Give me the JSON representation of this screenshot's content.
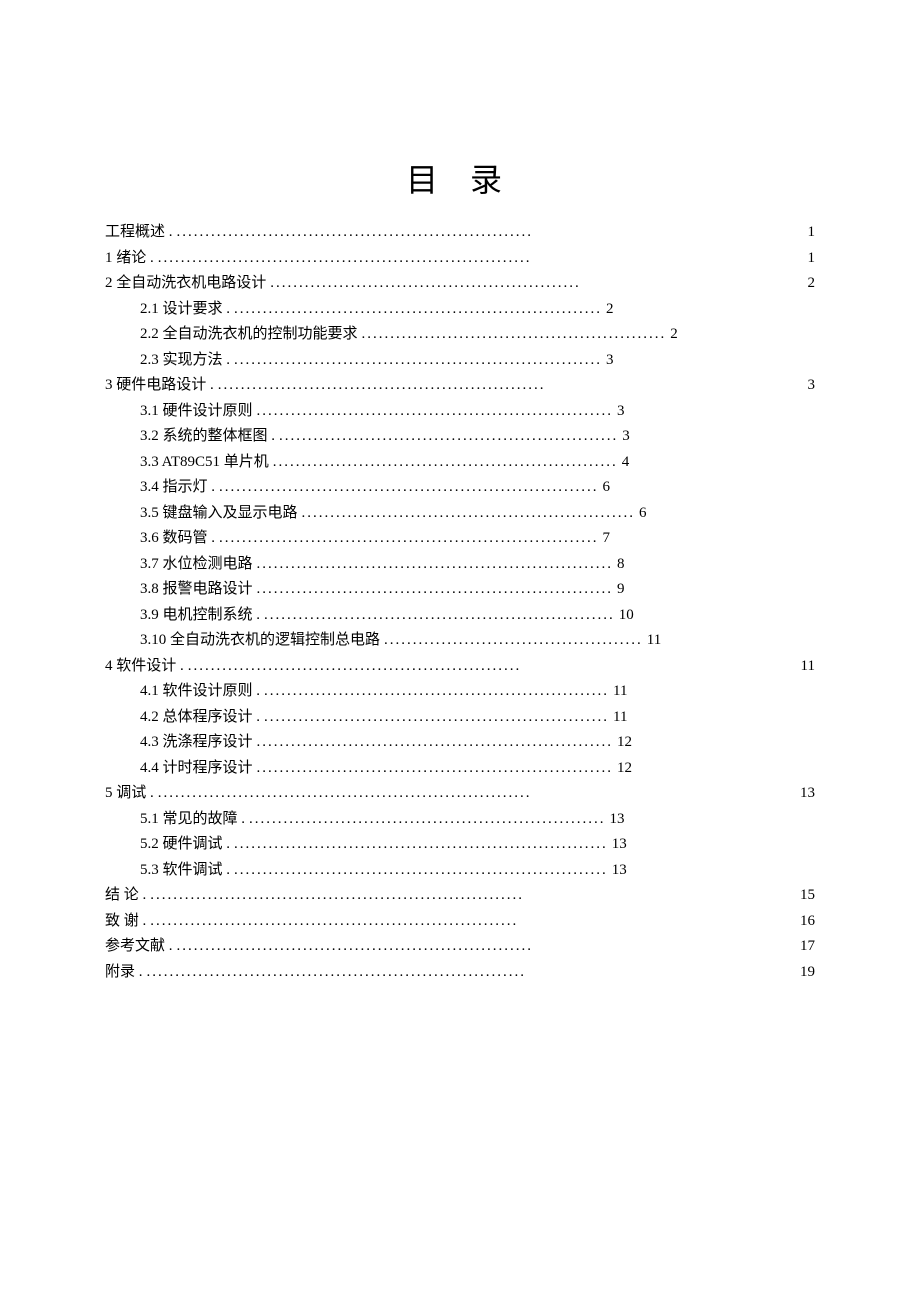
{
  "title": "目 录",
  "entries": [
    {
      "level": 0,
      "label": "工程概述 .",
      "dots": "..............................................................",
      "pageRight": "1"
    },
    {
      "level": 0,
      "label": "1 绪论 .",
      "dots": ".................................................................",
      "pageRight": "1"
    },
    {
      "level": 0,
      "label": "2 全自动洗衣机电路设计  ",
      "dots": "......................................................",
      "pageRight": "2"
    },
    {
      "level": 1,
      "label": "2.1  设计要求 .",
      "dots": "................................................................",
      "pageInline": "2"
    },
    {
      "level": 1,
      "label": "2.2  全自动洗衣机的控制功能要求  ",
      "dots": ".....................................................",
      "pageInline": "2"
    },
    {
      "level": 1,
      "label": "2.3  实现方法 .",
      "dots": "................................................................",
      "pageInline": "3"
    },
    {
      "level": 0,
      "label": "3 硬件电路设计 .",
      "dots": ".........................................................",
      "pageRight": "3"
    },
    {
      "level": 1,
      "label": "3.1 硬件设计原则  ",
      "dots": "..............................................................",
      "pageInline": "3"
    },
    {
      "level": 1,
      "label": "3.2  系统的整体框图 .",
      "dots": "...........................................................",
      "pageInline": "3"
    },
    {
      "level": 1,
      "label": "3.3 AT89C51 单片机 ",
      "dots": "............................................................",
      "pageInline": "4"
    },
    {
      "level": 1,
      "label": "3.4  指示灯 .",
      "dots": "..................................................................",
      "pageInline": "6"
    },
    {
      "level": 1,
      "label": "3.5 键盘输入及显示电路  ",
      "dots": "..........................................................",
      "pageInline": "6"
    },
    {
      "level": 1,
      "label": "3.6  数码管 .",
      "dots": "..................................................................",
      "pageInline": "7"
    },
    {
      "level": 1,
      "label": "3.7 水位检测电路  ",
      "dots": "..............................................................",
      "pageInline": "8"
    },
    {
      "level": 1,
      "label": "3.8 报警电路设计  ",
      "dots": "..............................................................",
      "pageInline": "9"
    },
    {
      "level": 1,
      "label": "3.9  电机控制系统 .",
      "dots": ".............................................................",
      "pageInline": "10"
    },
    {
      "level": 1,
      "label": "3.10  全自动洗衣机的逻辑控制总电路  ",
      "dots": ".............................................",
      "pageInline": "11"
    },
    {
      "level": 0,
      "label": "4    软件设计 .",
      "dots": "..........................................................",
      "pageRight": "11"
    },
    {
      "level": 1,
      "label": "4.1  软件设计原则  .",
      "dots": "............................................................",
      "pageInline": "11"
    },
    {
      "level": 1,
      "label": "4.2  总体程序设计  .",
      "dots": "............................................................",
      "pageInline": "11"
    },
    {
      "level": 1,
      "label": "4.3 洗涤程序设计  ",
      "dots": "..............................................................",
      "pageInline": "12"
    },
    {
      "level": 1,
      "label": "4.4 计时程序设计  ",
      "dots": "..............................................................",
      "pageInline": "12"
    },
    {
      "level": 0,
      "label": "5 调试 .",
      "dots": ".................................................................",
      "pageRight": "13"
    },
    {
      "level": 1,
      "label": "5.1  常见的故障 .",
      "dots": "..............................................................",
      "pageInline": "13"
    },
    {
      "level": 1,
      "label": "5.2 硬件调试 .",
      "dots": ".................................................................",
      "pageInline": "13"
    },
    {
      "level": 1,
      "label": "5.3 软件调试 .",
      "dots": ".................................................................",
      "pageInline": "13"
    },
    {
      "level": 0,
      "label": "结 论 .",
      "dots": ".................................................................",
      "pageRight": "15"
    },
    {
      "level": 0,
      "label": "致   谢 .",
      "dots": "................................................................",
      "pageRight": "16"
    },
    {
      "level": 0,
      "label": "参考文献 .",
      "dots": "..............................................................",
      "pageRight": "17"
    },
    {
      "level": 0,
      "label": "附录 .",
      "dots": "..................................................................",
      "pageRight": "19"
    }
  ]
}
